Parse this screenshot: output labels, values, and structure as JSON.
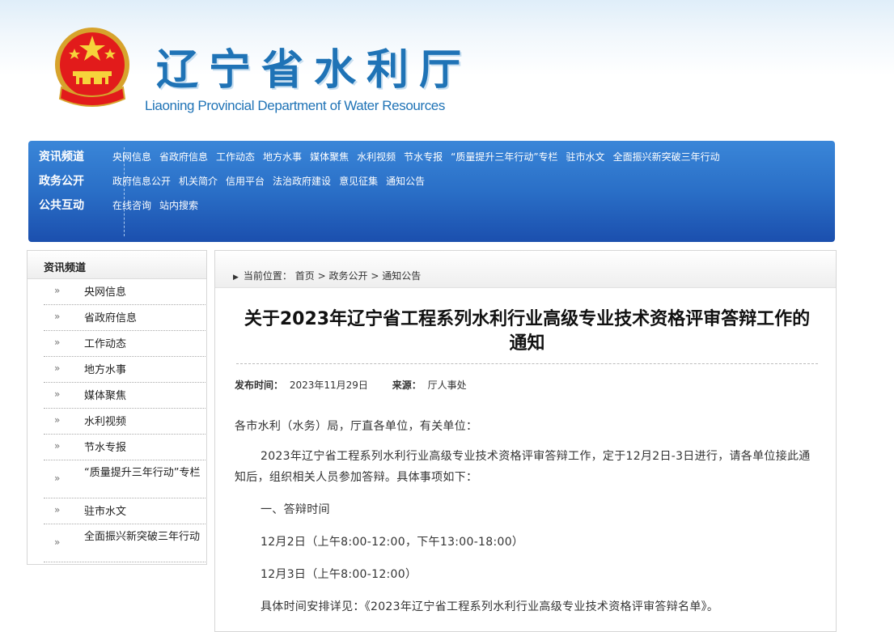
{
  "header": {
    "title": "辽宁省水利厅",
    "subtitle": "Liaoning Provincial Department of Water Resources",
    "emblem_icon": "national-emblem-icon"
  },
  "nav": {
    "rows": [
      {
        "heading": "资讯频道",
        "links": [
          "央网信息",
          "省政府信息",
          "工作动态",
          "地方水事",
          "媒体聚焦",
          "水利视频",
          "节水专报",
          "“质量提升三年行动”专栏",
          "驻市水文",
          "全面振兴新突破三年行动"
        ]
      },
      {
        "heading": "政务公开",
        "links": [
          "政府信息公开",
          "机关简介",
          "信用平台",
          "法治政府建设",
          "意见征集",
          "通知公告"
        ]
      },
      {
        "heading": "公共互动",
        "links": [
          "在线咨询",
          "站内搜索"
        ]
      }
    ]
  },
  "sidebar": {
    "heading": "资讯频道",
    "arrow": "»",
    "items": [
      "央网信息",
      "省政府信息",
      "工作动态",
      "地方水事",
      "媒体聚焦",
      "水利视频",
      "节水专报",
      "“质量提升三年行动”专栏",
      "驻市水文",
      "全面振兴新突破三年行动"
    ]
  },
  "breadcrumb": {
    "label": "当前位置：",
    "items": [
      "首页",
      "政务公开",
      "通知公告"
    ],
    "sep": ">"
  },
  "article": {
    "title": "关于2023年辽宁省工程系列水利行业高级专业技术资格评审答辩工作的通知",
    "publish_label": "发布时间：",
    "publish_date": "2023年11月29日",
    "source_label": "来源：",
    "source": "厅人事处",
    "salutation": "各市水利（水务）局，厅直各单位，有关单位：",
    "intro": "2023年辽宁省工程系列水利行业高级专业技术资格评审答辩工作，定于12月2日-3日进行，请各单位接此通知后，组织相关人员参加答辩。具体事项如下：",
    "section1": "一、答辩时间",
    "time1": "12月2日（上午8:00-12:00，下午13:00-18:00）",
    "time2": "12月3日（上午8:00-12:00）",
    "time_detail": "具体时间安排详见：《2023年辽宁省工程系列水利行业高级专业技术资格评审答辩名单》。"
  },
  "colors": {
    "title_blue": "#1f73b6",
    "nav_top": "#3a86d8",
    "nav_bottom": "#1b4fae"
  }
}
